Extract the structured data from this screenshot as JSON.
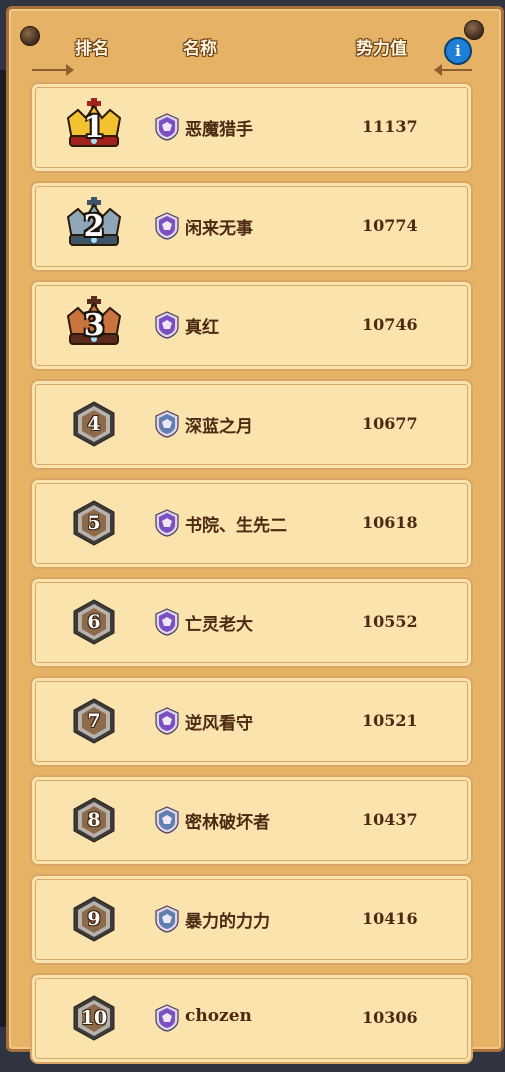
{
  "header": {
    "rank_label": "排名",
    "name_label": "名称",
    "power_label": "势力值",
    "info_label": "i"
  },
  "rows": [
    {
      "rank": "1",
      "name": "恶魔猎手",
      "value": "11137",
      "badge": "gold-crown",
      "emblem": "purple"
    },
    {
      "rank": "2",
      "name": "闲来无事",
      "value": "10774",
      "badge": "silver-crown",
      "emblem": "purple"
    },
    {
      "rank": "3",
      "name": "真红",
      "value": "10746",
      "badge": "bronze-crown",
      "emblem": "purple"
    },
    {
      "rank": "4",
      "name": "深蓝之月",
      "value": "10677",
      "badge": "hexagon",
      "emblem": "blue"
    },
    {
      "rank": "5",
      "name": "书院、生先二",
      "value": "10618",
      "badge": "hexagon",
      "emblem": "purple"
    },
    {
      "rank": "6",
      "name": "亡灵老大",
      "value": "10552",
      "badge": "hexagon",
      "emblem": "purple"
    },
    {
      "rank": "7",
      "name": "逆风看守",
      "value": "10521",
      "badge": "hexagon",
      "emblem": "purple"
    },
    {
      "rank": "8",
      "name": "密林破坏者",
      "value": "10437",
      "badge": "hexagon",
      "emblem": "blue"
    },
    {
      "rank": "9",
      "name": "暴力的力力",
      "value": "10416",
      "badge": "hexagon",
      "emblem": "blue"
    },
    {
      "rank": "10",
      "name": "chozen",
      "value": "10306",
      "badge": "hexagon",
      "emblem": "purple"
    }
  ],
  "colors": {
    "gold": "#f2c230",
    "silver": "#8fa6b8",
    "bronze": "#c8743c",
    "emblem_purple": "#7b4fc2",
    "emblem_blue": "#5f7fb0"
  }
}
